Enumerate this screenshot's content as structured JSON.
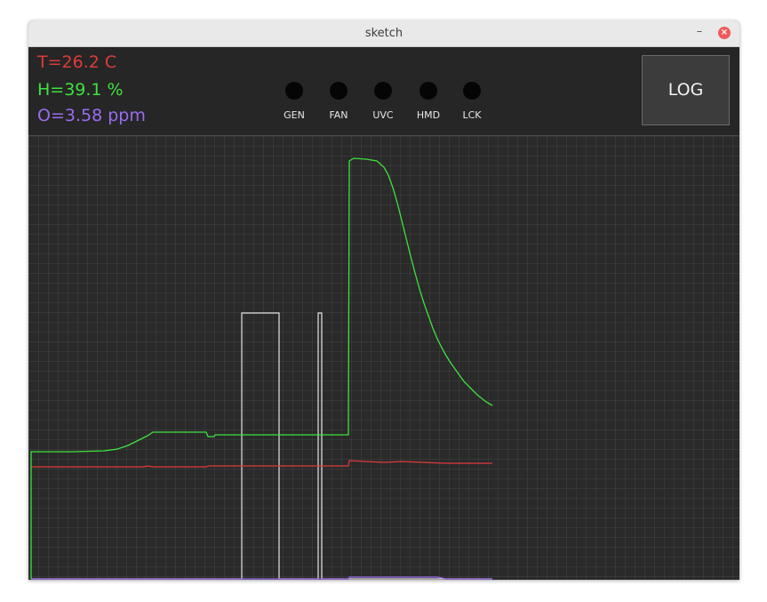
{
  "window": {
    "title": "sketch",
    "minimize_glyph": "–",
    "close_glyph": "×"
  },
  "readings": {
    "temperature": "T=26.2 C",
    "humidity": "H=39.1 %",
    "ozone": "O=3.58 ppm"
  },
  "indicators": [
    {
      "label": "GEN",
      "state": "off"
    },
    {
      "label": "FAN",
      "state": "off"
    },
    {
      "label": "UVC",
      "state": "off"
    },
    {
      "label": "HMD",
      "state": "off"
    },
    {
      "label": "LCK",
      "state": "off"
    }
  ],
  "log_button": {
    "label": "LOG"
  },
  "colors": {
    "temperature": "#e03a3a",
    "humidity": "#3fe23f",
    "ozone": "#9a6cf0",
    "generator": "#e6e6e6",
    "indicator_off": "#050505",
    "background": "#2a2a2a"
  }
}
